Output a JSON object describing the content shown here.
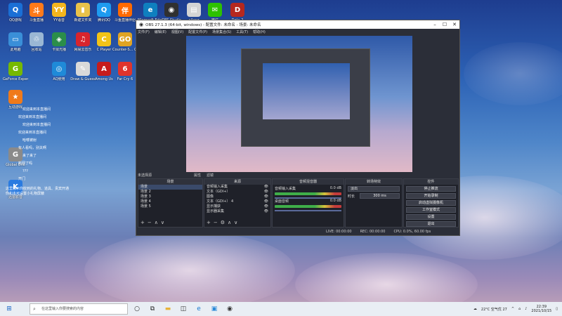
{
  "desktop": {
    "icons": [
      {
        "label": "QQ游戏",
        "color": "#1a6fd6",
        "glyph": "Q"
      },
      {
        "label": "斗鱼直播",
        "color": "#ff7a1a",
        "glyph": "斗"
      },
      {
        "label": "YY语音",
        "color": "#f3b51d",
        "glyph": "YY"
      },
      {
        "label": "新建文件夹",
        "color": "#e8c24a",
        "glyph": "▮"
      },
      {
        "label": "腾讯QQ",
        "color": "#1e9bf0",
        "glyph": "Q"
      },
      {
        "label": "斗鱼直播伴侣",
        "color": "#ff6a00",
        "glyph": "伴"
      },
      {
        "label": "Microsoft Edge",
        "color": "#0f7fbf",
        "glyph": "e"
      },
      {
        "label": "OBS Studio",
        "color": "#303030",
        "glyph": "◉"
      },
      {
        "label": "ailang",
        "color": "#d4d4d4",
        "glyph": "▤"
      },
      {
        "label": "微信",
        "color": "#2dc100",
        "glyph": "✉"
      },
      {
        "label": "Dota 2",
        "color": "#b5281f",
        "glyph": "D"
      },
      {
        "label": "此电脑",
        "color": "#3a8fd8",
        "glyph": "▭"
      },
      {
        "label": "回收站",
        "color": "#9ab7d4",
        "glyph": "♲"
      },
      {
        "label": "卡狱光播",
        "color": "#2b8e4a",
        "glyph": "◈"
      },
      {
        "label": "网易云音乐",
        "color": "#d8242d",
        "glyph": "♫"
      },
      {
        "label": "C Player",
        "color": "#f2c316",
        "glyph": "C"
      },
      {
        "label": "Counter-S... Global Off...",
        "color": "#e0a423",
        "glyph": "GO"
      },
      {
        "label": "GeForce Experience",
        "color": "#76b900",
        "glyph": "G"
      },
      {
        "label": "AQ使用",
        "color": "#1f8ad8",
        "glyph": "◎"
      },
      {
        "label": "Draw & Guess",
        "color": "#d9d9d9",
        "glyph": "✎"
      },
      {
        "label": "Among Us",
        "color": "#c51c1c",
        "glyph": "A"
      },
      {
        "label": "Far Cry 6",
        "color": "#e0342c",
        "glyph": "6"
      },
      {
        "label": "互动游戏",
        "color": "#f07a1a",
        "glyph": "★"
      },
      {
        "label": "Global One",
        "color": "#8a8a8a",
        "glyph": "G"
      },
      {
        "label": "迅雷影音",
        "color": "#2a7be0",
        "glyph": "K"
      }
    ]
  },
  "chat": [
    {
      "name": "",
      "msg": "欢迎来到本直播间"
    },
    {
      "name": "",
      "msg": "欢迎来到本直播间"
    },
    {
      "name": "",
      "msg": "欢迎来到本直播间"
    },
    {
      "name": "",
      "msg": "欢迎来到本直播间"
    },
    {
      "name": "",
      "msg": "哈喽被射"
    },
    {
      "name": "",
      "msg": "有人看吗，别关啊"
    },
    {
      "name": "",
      "msg": "来了来了"
    },
    {
      "name": "",
      "msg": "新网了吗"
    },
    {
      "name": "",
      "msg": "???"
    },
    {
      "name": "",
      "msg": "开门"
    }
  ],
  "chat_footer": "这里展示你收到的礼物、道具、贵宾开通\n你和本可设置小礼物屏蔽",
  "obs": {
    "title": "OBS 27.1.3 (64-bit, windows) - 配置文件: 未命名 - 场景: 未命名",
    "menu": [
      "文件(F)",
      "编辑(E)",
      "视图(V)",
      "配置文件(P)",
      "场景集合(S)",
      "工具(T)",
      "帮助(H)"
    ],
    "subtabs": [
      "未选择源",
      "属性",
      "滤镜"
    ],
    "scenes_header": "场景",
    "scenes": [
      "场景",
      "场景 2",
      "场景 3",
      "场景 4",
      "场景 5"
    ],
    "sources_header": "来源",
    "sources": [
      "音频输入采集",
      "文本（GDI+）",
      "图像",
      "文本（GDI+） 4",
      "显示捕获",
      "显示器采集"
    ],
    "mixer_header": "音频混音器",
    "mixer": [
      {
        "label": "音频输入采集",
        "value": "0.0 dB"
      },
      {
        "label": "桌面音频",
        "value": "0.0 dB"
      }
    ],
    "transition_header": "转场特效",
    "transition_type": "淡出",
    "duration_label": "时长",
    "duration_value": "300 ms",
    "controls_header": "控件",
    "controls": [
      "停止推流",
      "开始录制",
      "启动虚拟摄像机",
      "工作室模式",
      "设置",
      "退出"
    ],
    "status": {
      "live": "LIVE: 00:00:00",
      "rec": "REC: 00:00:00",
      "cpu": "CPU: 0.0%, 60.00 fps"
    }
  },
  "taskbar": {
    "search_placeholder": "在这里输入你要搜索的内容",
    "weather": "22°C 空气优 27",
    "time": "22:39",
    "date": "2021/10/15"
  }
}
